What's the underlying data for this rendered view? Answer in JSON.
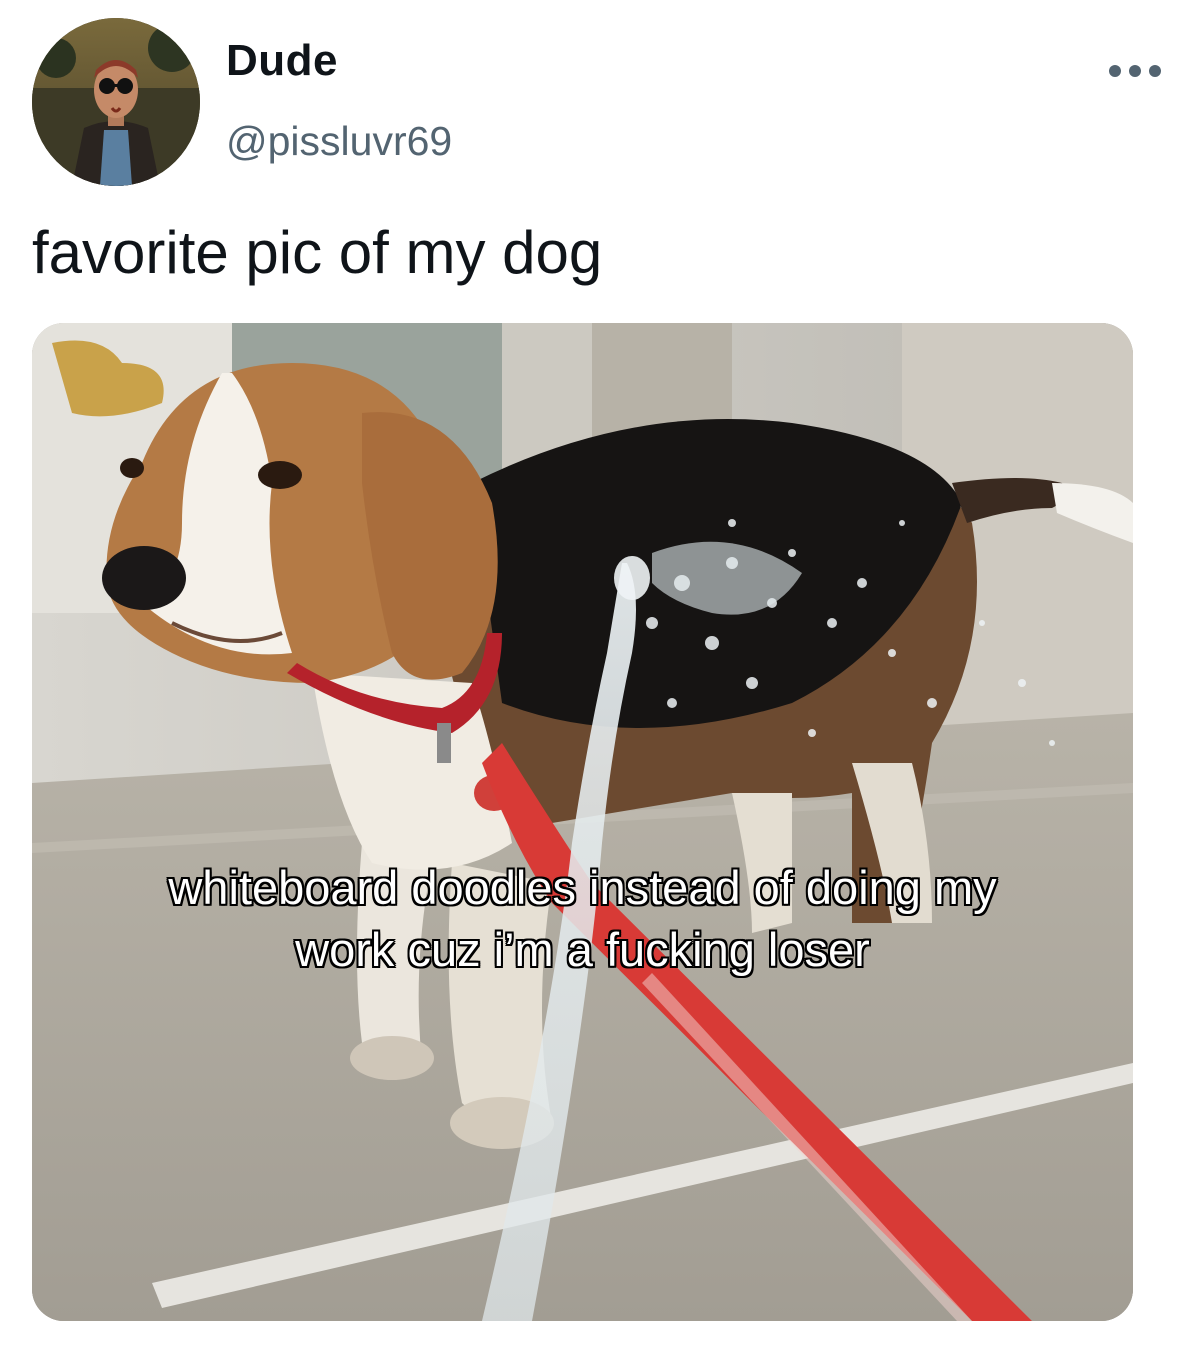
{
  "author": {
    "display_name": "Dude",
    "handle": "@pissluvr69"
  },
  "tweet": {
    "text": "favorite pic of my dog",
    "more_icon": "more-horizontal-icon"
  },
  "media": {
    "caption_lines": [
      "whiteboard doodles instead of doing my",
      "work cuz i’m a fucking loser"
    ]
  },
  "colors": {
    "primary_text": "#0f1419",
    "secondary_text": "#536471",
    "leash": "#d83a36",
    "collar": "#b5222b"
  }
}
